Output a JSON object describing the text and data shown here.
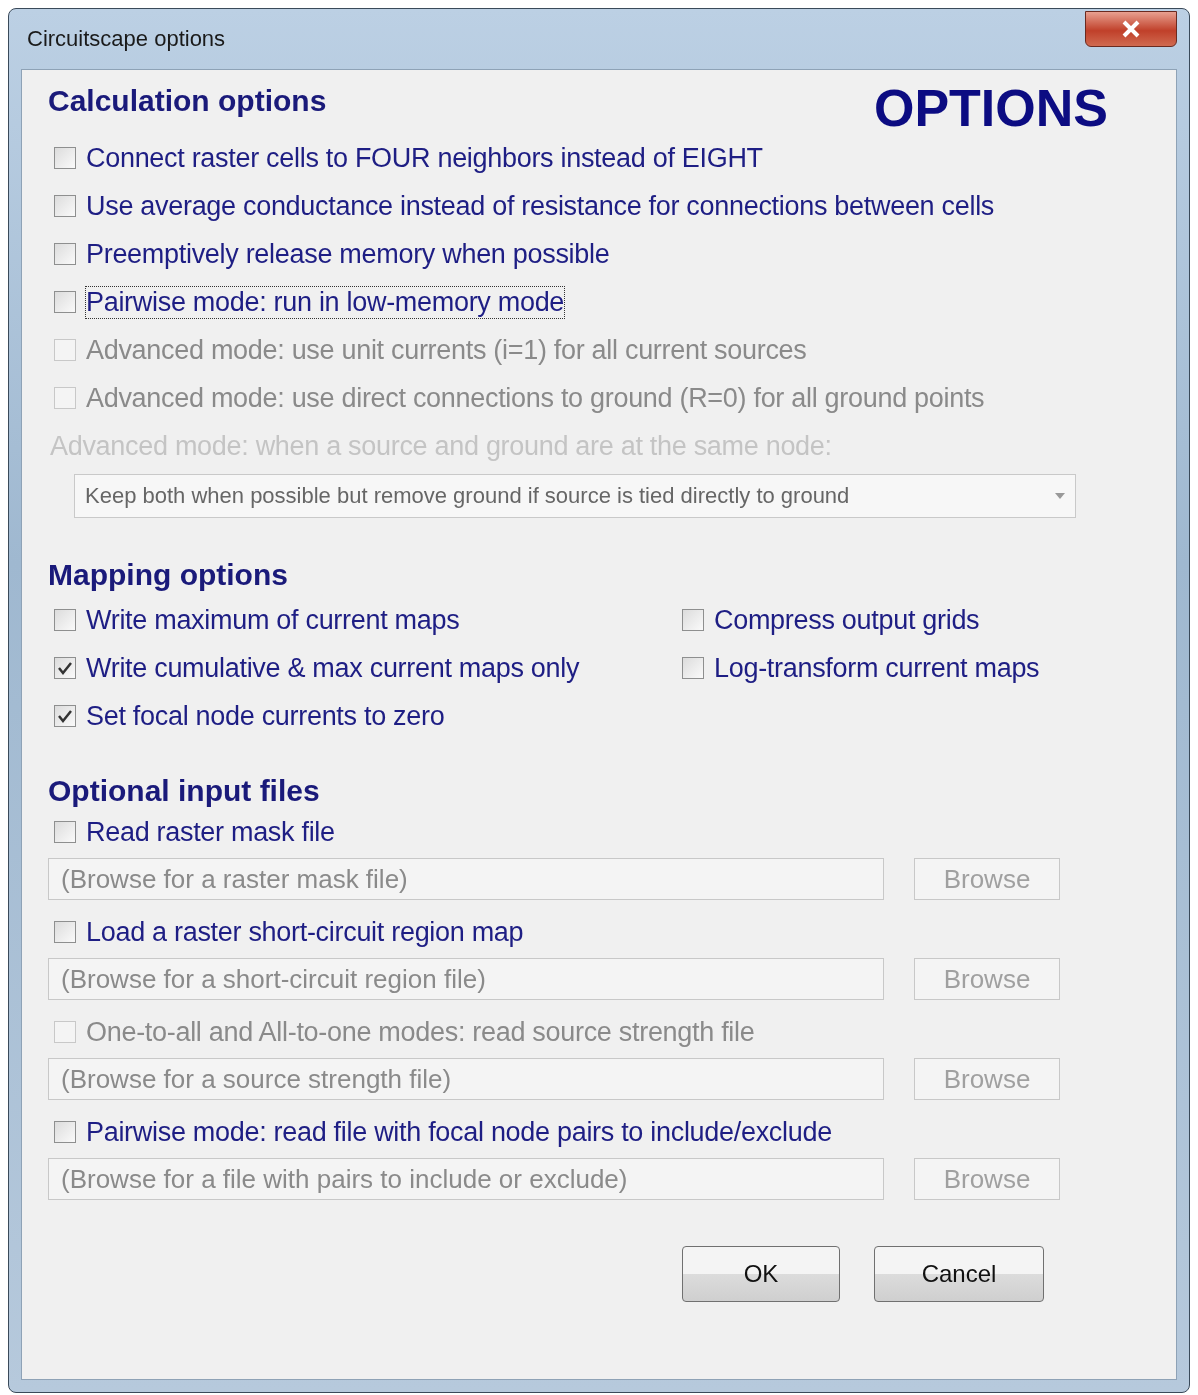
{
  "window": {
    "title": "Circuitscape options"
  },
  "banner": "OPTIONS",
  "calculation": {
    "heading": "Calculation options",
    "options": [
      {
        "label": "Connect raster cells to FOUR neighbors instead of EIGHT",
        "checked": false,
        "disabled": false,
        "focused": false
      },
      {
        "label": "Use average conductance instead of resistance for connections between cells",
        "checked": false,
        "disabled": false,
        "focused": false
      },
      {
        "label": "Preemptively release memory when possible",
        "checked": false,
        "disabled": false,
        "focused": false
      },
      {
        "label": "Pairwise mode: run in low-memory mode",
        "checked": false,
        "disabled": false,
        "focused": true
      },
      {
        "label": "Advanced mode: use unit currents (i=1) for all current sources",
        "checked": false,
        "disabled": true,
        "focused": false
      },
      {
        "label": "Advanced mode: use direct connections to ground (R=0) for all ground points",
        "checked": false,
        "disabled": true,
        "focused": false
      }
    ],
    "dropdown_label": "Advanced mode: when a source and ground are at the same node:",
    "dropdown": {
      "value": "Keep both when possible but remove ground if source is tied directly to ground",
      "disabled": true
    }
  },
  "mapping": {
    "heading": "Mapping options",
    "options": [
      {
        "label": "Write maximum of current maps",
        "checked": false
      },
      {
        "label": "Compress output grids",
        "checked": false
      },
      {
        "label": "Write cumulative & max current maps only",
        "checked": true
      },
      {
        "label": "Log-transform current maps",
        "checked": false
      },
      {
        "label": "Set focal node currents to zero",
        "checked": true
      }
    ]
  },
  "input_files": {
    "heading": "Optional input files",
    "files": [
      {
        "label": "Read raster mask file",
        "checked": false,
        "disabled": false,
        "placeholder": "(Browse for a raster mask file)",
        "button": "Browse",
        "button_disabled": true
      },
      {
        "label": "Load a raster short-circuit region map",
        "checked": false,
        "disabled": false,
        "placeholder": "(Browse for a short-circuit region file)",
        "button": "Browse",
        "button_disabled": true
      },
      {
        "label": "One-to-all and All-to-one modes: read source strength file",
        "checked": false,
        "disabled": true,
        "placeholder": "(Browse for a source strength file)",
        "button": "Browse",
        "button_disabled": true
      },
      {
        "label": "Pairwise mode: read file with focal node pairs to include/exclude",
        "checked": false,
        "disabled": false,
        "placeholder": "(Browse for a file with pairs to include or exclude)",
        "button": "Browse",
        "button_disabled": true
      }
    ]
  },
  "buttons": [
    {
      "label": "OK"
    },
    {
      "label": "Cancel"
    }
  ]
}
